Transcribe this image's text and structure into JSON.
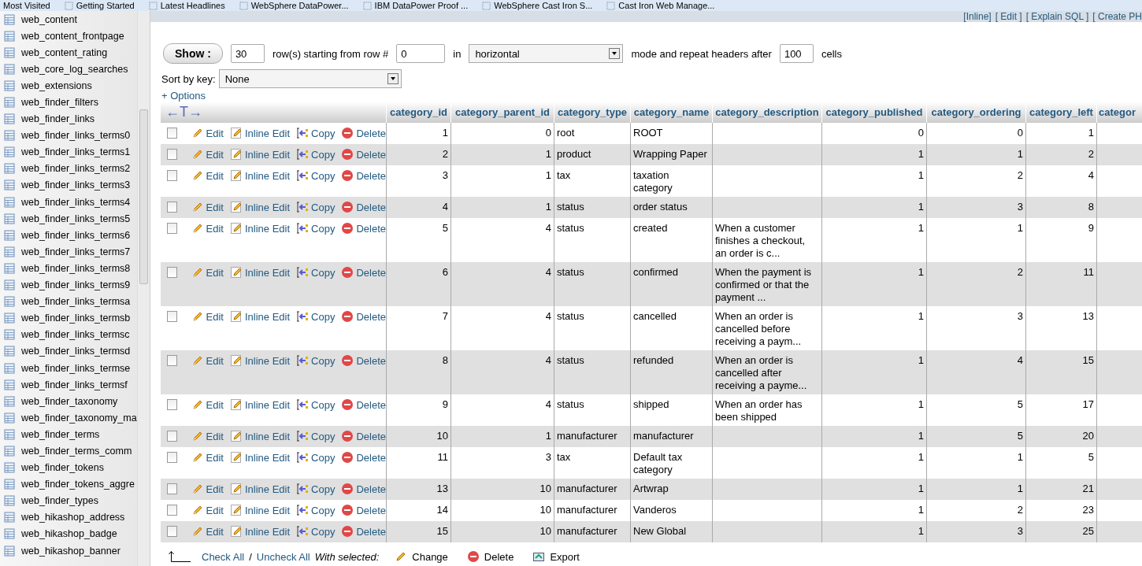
{
  "bookmarks": [
    "Most Visited",
    "Getting Started",
    "Latest Headlines",
    "WebSphere DataPower...",
    "IBM DataPower Proof ...",
    "WebSphere Cast Iron S...",
    "Cast Iron Web Manage..."
  ],
  "sidebar": {
    "items": [
      "web_content",
      "web_content_frontpage",
      "web_content_rating",
      "web_core_log_searches",
      "web_extensions",
      "web_finder_filters",
      "web_finder_links",
      "web_finder_links_terms0",
      "web_finder_links_terms1",
      "web_finder_links_terms2",
      "web_finder_links_terms3",
      "web_finder_links_terms4",
      "web_finder_links_terms5",
      "web_finder_links_terms6",
      "web_finder_links_terms7",
      "web_finder_links_terms8",
      "web_finder_links_terms9",
      "web_finder_links_termsa",
      "web_finder_links_termsb",
      "web_finder_links_termsc",
      "web_finder_links_termsd",
      "web_finder_links_termse",
      "web_finder_links_termsf",
      "web_finder_taxonomy",
      "web_finder_taxonomy_ma",
      "web_finder_terms",
      "web_finder_terms_comm",
      "web_finder_tokens",
      "web_finder_tokens_aggre",
      "web_finder_types",
      "web_hikashop_address",
      "web_hikashop_badge",
      "web_hikashop_banner"
    ]
  },
  "query_links": [
    "[Inline]",
    "[ Edit ]",
    "[ Explain SQL ]",
    "[ Create PH"
  ],
  "navigation": {
    "show_button": "Show :",
    "rows": "30",
    "rows_label": "row(s) starting from row #",
    "start": "0",
    "in_label": "in",
    "mode": "horizontal",
    "mode_label": "mode and repeat headers after",
    "repeat": "100",
    "cells_label": "cells",
    "sort_label": "Sort by key:",
    "sort_value": "None",
    "options_link": "+ Options"
  },
  "table": {
    "toggle": "←T→",
    "columns": [
      {
        "label": "category_id",
        "kind": "number"
      },
      {
        "label": "category_parent_id",
        "kind": "number"
      },
      {
        "label": "category_type",
        "kind": "text"
      },
      {
        "label": "category_name",
        "kind": "text"
      },
      {
        "label": "category_description",
        "kind": "text"
      },
      {
        "label": "category_published",
        "kind": "number"
      },
      {
        "label": "category_ordering",
        "kind": "number"
      },
      {
        "label": "category_left",
        "kind": "number"
      },
      {
        "label": "categor",
        "kind": "text"
      }
    ],
    "rows": [
      {
        "checked": false,
        "actions": [
          "Edit",
          "Inline Edit",
          "Copy",
          "Delete"
        ],
        "cells": [
          "1",
          "0",
          "root",
          "ROOT",
          "",
          "0",
          "0",
          "1"
        ]
      },
      {
        "checked": false,
        "actions": [
          "Edit",
          "Inline Edit",
          "Copy",
          "Delete"
        ],
        "cells": [
          "2",
          "1",
          "product",
          "Wrapping Paper",
          "",
          "1",
          "1",
          "2"
        ]
      },
      {
        "checked": false,
        "actions": [
          "Edit",
          "Inline Edit",
          "Copy",
          "Delete"
        ],
        "cells": [
          "3",
          "1",
          "tax",
          "taxation category",
          "",
          "1",
          "2",
          "4"
        ]
      },
      {
        "checked": false,
        "actions": [
          "Edit",
          "Inline Edit",
          "Copy",
          "Delete"
        ],
        "cells": [
          "4",
          "1",
          "status",
          "order status",
          "",
          "1",
          "3",
          "8"
        ]
      },
      {
        "checked": false,
        "actions": [
          "Edit",
          "Inline Edit",
          "Copy",
          "Delete"
        ],
        "cells": [
          "5",
          "4",
          "status",
          "created",
          "When a customer finishes a checkout, an order is c...",
          "1",
          "1",
          "9"
        ]
      },
      {
        "checked": false,
        "actions": [
          "Edit",
          "Inline Edit",
          "Copy",
          "Delete"
        ],
        "cells": [
          "6",
          "4",
          "status",
          "confirmed",
          "When the payment is confirmed or that the payment ...",
          "1",
          "2",
          "11"
        ]
      },
      {
        "checked": false,
        "actions": [
          "Edit",
          "Inline Edit",
          "Copy",
          "Delete"
        ],
        "cells": [
          "7",
          "4",
          "status",
          "cancelled",
          "When an order is cancelled before receiving a paym...",
          "1",
          "3",
          "13"
        ]
      },
      {
        "checked": false,
        "actions": [
          "Edit",
          "Inline Edit",
          "Copy",
          "Delete"
        ],
        "cells": [
          "8",
          "4",
          "status",
          "refunded",
          "When an order is cancelled after receiving a payme...",
          "1",
          "4",
          "15"
        ]
      },
      {
        "checked": false,
        "actions": [
          "Edit",
          "Inline Edit",
          "Copy",
          "Delete"
        ],
        "cells": [
          "9",
          "4",
          "status",
          "shipped",
          "When an order has been shipped",
          "1",
          "5",
          "17"
        ]
      },
      {
        "checked": false,
        "actions": [
          "Edit",
          "Inline Edit",
          "Copy",
          "Delete"
        ],
        "cells": [
          "10",
          "1",
          "manufacturer",
          "manufacturer",
          "",
          "1",
          "5",
          "20"
        ]
      },
      {
        "checked": false,
        "actions": [
          "Edit",
          "Inline Edit",
          "Copy",
          "Delete"
        ],
        "cells": [
          "11",
          "3",
          "tax",
          "Default tax category",
          "",
          "1",
          "1",
          "5"
        ]
      },
      {
        "checked": false,
        "actions": [
          "Edit",
          "Inline Edit",
          "Copy",
          "Delete"
        ],
        "cells": [
          "13",
          "10",
          "manufacturer",
          "Artwrap",
          "",
          "1",
          "1",
          "21"
        ]
      },
      {
        "checked": false,
        "actions": [
          "Edit",
          "Inline Edit",
          "Copy",
          "Delete"
        ],
        "cells": [
          "14",
          "10",
          "manufacturer",
          "Vanderos",
          "",
          "1",
          "2",
          "23"
        ]
      },
      {
        "checked": false,
        "actions": [
          "Edit",
          "Inline Edit",
          "Copy",
          "Delete"
        ],
        "cells": [
          "15",
          "10",
          "manufacturer",
          "New Global",
          "",
          "1",
          "3",
          "25"
        ]
      }
    ]
  },
  "footer": {
    "check_all": "Check All",
    "separator": "/",
    "uncheck_all": "Uncheck All",
    "with_selected": "With selected:",
    "actions": [
      "Change",
      "Delete",
      "Export"
    ]
  }
}
